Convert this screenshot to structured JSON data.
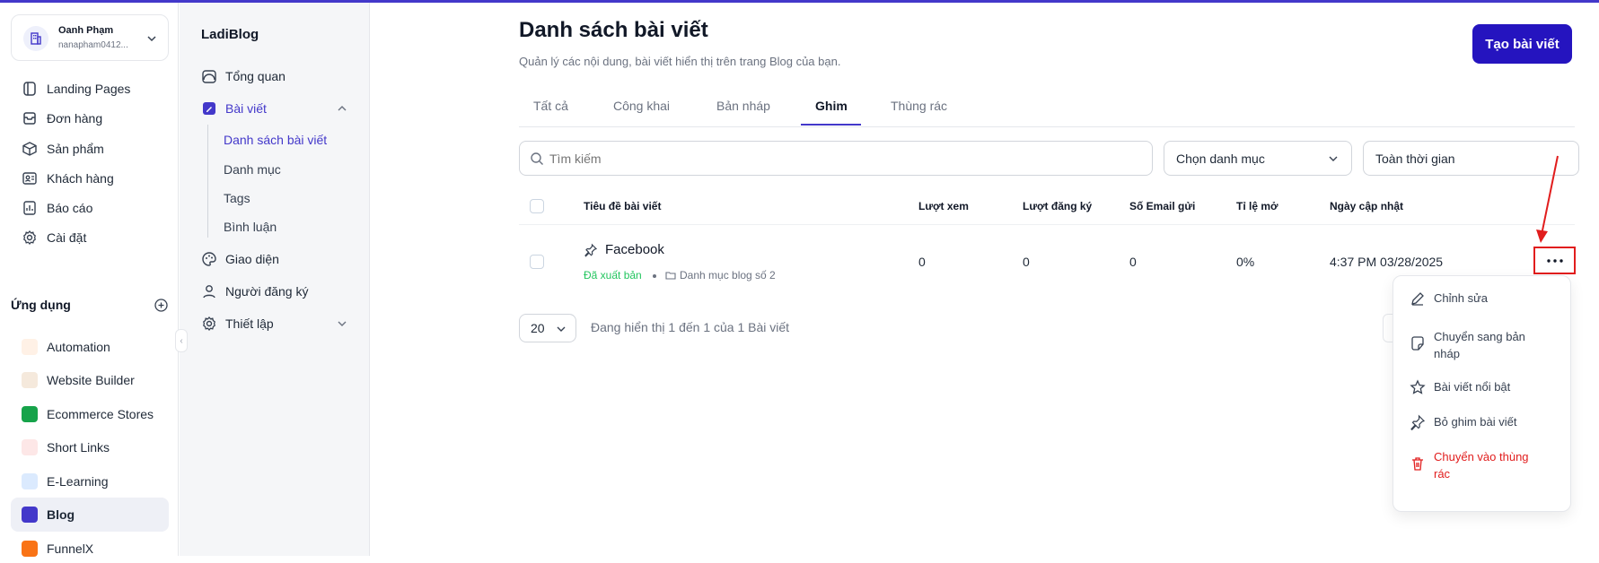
{
  "colors": {
    "accent": "#4338ca",
    "primary_button": "#2514bf",
    "danger": "#e11d1d",
    "success": "#22c55e"
  },
  "account": {
    "name": "Oanh Phạm",
    "email": "nanapham0412..."
  },
  "main_nav": [
    {
      "label": "Landing Pages",
      "icon": "landing-pages-icon"
    },
    {
      "label": "Đơn hàng",
      "icon": "orders-icon"
    },
    {
      "label": "Sản phẩm",
      "icon": "box-icon"
    },
    {
      "label": "Khách hàng",
      "icon": "customers-icon"
    },
    {
      "label": "Báo cáo",
      "icon": "report-icon"
    },
    {
      "label": "Cài đặt",
      "icon": "gear-icon"
    }
  ],
  "apps_section": {
    "title": "Ứng dụng"
  },
  "apps": [
    {
      "label": "Automation",
      "icon": "lightning-icon"
    },
    {
      "label": "Website Builder",
      "icon": "globe-icon"
    },
    {
      "label": "Ecommerce Stores",
      "icon": "store-icon"
    },
    {
      "label": "Short Links",
      "icon": "link-icon"
    },
    {
      "label": "E-Learning",
      "icon": "book-icon"
    },
    {
      "label": "Blog",
      "icon": "blog-icon"
    },
    {
      "label": "FunnelX",
      "icon": "funnel-icon"
    }
  ],
  "blog_nav": {
    "brand": "LadiBlog",
    "items": [
      {
        "label": "Tổng quan"
      },
      {
        "label": "Bài viết"
      },
      {
        "label": "Giao diện"
      },
      {
        "label": "Người đăng ký"
      },
      {
        "label": "Thiết lập"
      }
    ],
    "children": [
      {
        "label": "Danh sách bài viết"
      },
      {
        "label": "Danh mục"
      },
      {
        "label": "Tags"
      },
      {
        "label": "Bình luận"
      }
    ]
  },
  "page": {
    "title": "Danh sách bài viết",
    "subtitle": "Quản lý các nội dung, bài viết hiển thị trên trang Blog của bạn.",
    "create_button": "Tạo bài viết"
  },
  "tabs": [
    {
      "label": "Tất cả"
    },
    {
      "label": "Công khai"
    },
    {
      "label": "Bản nháp"
    },
    {
      "label": "Ghim"
    },
    {
      "label": "Thùng rác"
    }
  ],
  "filters": {
    "search_placeholder": "Tìm kiếm",
    "category": "Chọn danh mục",
    "time": "Toàn thời gian"
  },
  "table": {
    "columns": [
      "Tiêu đề bài viết",
      "Lượt xem",
      "Lượt đăng ký",
      "Số Email gửi",
      "Tỉ lệ mở",
      "Ngày cập nhật"
    ],
    "rows": [
      {
        "title": "Facebook",
        "status": "Đã xuất bản",
        "category": "Danh mục blog số 2",
        "views": "0",
        "signups": "0",
        "emails": "0",
        "open_rate": "0%",
        "updated": "4:37 PM 03/28/2025"
      }
    ]
  },
  "pagination": {
    "page_size": "20",
    "info": "Đang hiển thị 1 đến 1 của 1 Bài viết"
  },
  "row_menu": [
    {
      "label": "Chỉnh sửa",
      "icon": "pencil-icon"
    },
    {
      "label": "Chuyển sang bản nháp",
      "icon": "draft-icon"
    },
    {
      "label": "Bài viết nổi bật",
      "icon": "star-icon"
    },
    {
      "label": "Bỏ ghim bài viết",
      "icon": "pin-icon"
    },
    {
      "label": "Chuyển vào thùng rác",
      "icon": "trash-icon"
    }
  ]
}
